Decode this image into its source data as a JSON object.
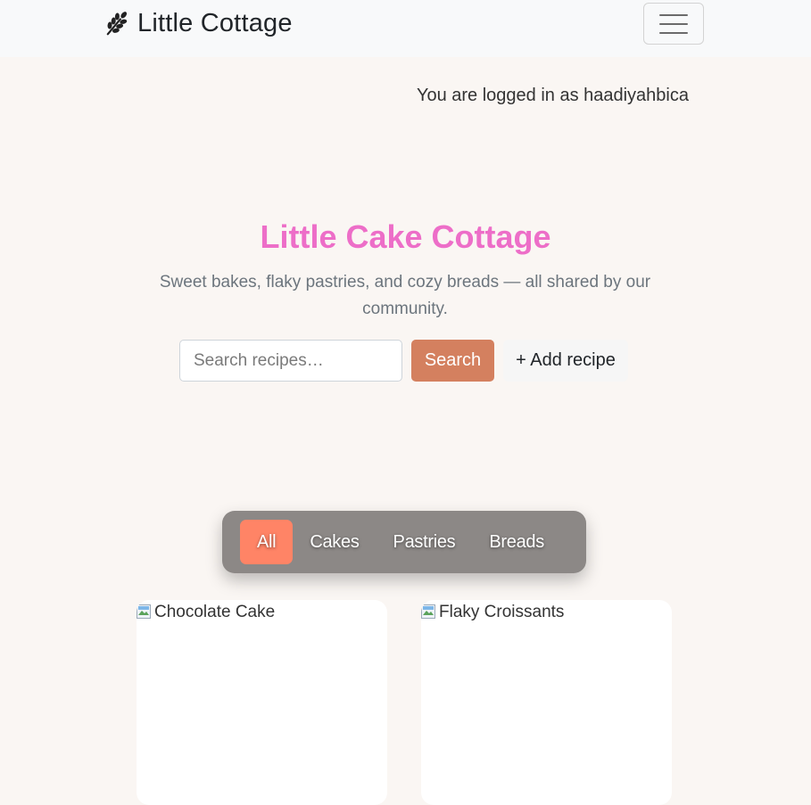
{
  "navbar": {
    "brand": "Little Cottage",
    "brand_icon": "wheat-icon",
    "menu_icon": "hamburger-menu-icon"
  },
  "user": {
    "logged_in_text": "You are logged in as haadiyahbica"
  },
  "hero": {
    "title": "Little Cake Cottage",
    "subtitle": "Sweet bakes, flaky pastries, and cozy breads — all shared by our community.",
    "title_color": "#ed6ec8"
  },
  "search": {
    "placeholder": "Search recipes…",
    "value": "",
    "button_label": "Search",
    "add_label": "+ Add recipe",
    "button_color": "#d4805f"
  },
  "filters": {
    "items": [
      {
        "label": "All",
        "active": true
      },
      {
        "label": "Cakes",
        "active": false
      },
      {
        "label": "Pastries",
        "active": false
      },
      {
        "label": "Breads",
        "active": false
      }
    ],
    "active_color": "#ff8466"
  },
  "recipes": [
    {
      "image_alt": "Chocolate Cake"
    },
    {
      "image_alt": "Flaky Croissants"
    }
  ]
}
